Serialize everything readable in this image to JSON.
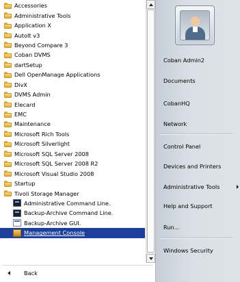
{
  "programs": {
    "items": [
      {
        "label": "Accessories",
        "kind": "folder"
      },
      {
        "label": "Administrative Tools",
        "kind": "folder"
      },
      {
        "label": "Application X",
        "kind": "folder"
      },
      {
        "label": "AutoIt v3",
        "kind": "folder"
      },
      {
        "label": "Beyond Compare 3",
        "kind": "folder"
      },
      {
        "label": "Coban DVMS",
        "kind": "folder"
      },
      {
        "label": "dartSetup",
        "kind": "folder"
      },
      {
        "label": "Dell OpenManage Applications",
        "kind": "folder"
      },
      {
        "label": "DivX",
        "kind": "folder"
      },
      {
        "label": "DVMS Admin",
        "kind": "folder"
      },
      {
        "label": "Elecard",
        "kind": "folder"
      },
      {
        "label": "EMC",
        "kind": "folder"
      },
      {
        "label": "Maintenance",
        "kind": "folder"
      },
      {
        "label": "Microsoft Rich Tools",
        "kind": "folder"
      },
      {
        "label": "Microsoft Silverlight",
        "kind": "folder"
      },
      {
        "label": "Microsoft SQL Server 2008",
        "kind": "folder"
      },
      {
        "label": "Microsoft SQL Server 2008 R2",
        "kind": "folder"
      },
      {
        "label": "Microsoft Visual Studio 2008",
        "kind": "folder"
      },
      {
        "label": "Startup",
        "kind": "folder"
      },
      {
        "label": "Tivoli Storage Manager",
        "kind": "folder"
      },
      {
        "label": "Administrative Command Line.",
        "kind": "terminal"
      },
      {
        "label": "Backup-Archive Command Line.",
        "kind": "terminal"
      },
      {
        "label": "Backup-Archive GUI.",
        "kind": "gui"
      },
      {
        "label": "Management Console",
        "kind": "console",
        "selected": true
      }
    ],
    "back_label": "Back"
  },
  "right_pane": {
    "user_picture_icon": "user-avatar-icon",
    "items": [
      {
        "label": "Coban Admin2",
        "name": "user-name-link"
      },
      {
        "label": "Documents",
        "name": "documents-link"
      },
      {
        "label": "CobanHQ",
        "name": "cobanhq-link"
      },
      {
        "label": "Network",
        "name": "network-link"
      },
      {
        "label": "Control Panel",
        "name": "control-panel-link"
      },
      {
        "label": "Devices and Printers",
        "name": "devices-printers-link"
      },
      {
        "label": "Administrative Tools",
        "name": "administrative-tools-link",
        "submenu": true
      },
      {
        "label": "Help and Support",
        "name": "help-support-link"
      },
      {
        "label": "Run...",
        "name": "run-link"
      },
      {
        "label": "Windows Security",
        "name": "windows-security-link"
      }
    ]
  },
  "colors": {
    "selection": "#1c3f9c",
    "right_pane": "#d9dfe5"
  }
}
